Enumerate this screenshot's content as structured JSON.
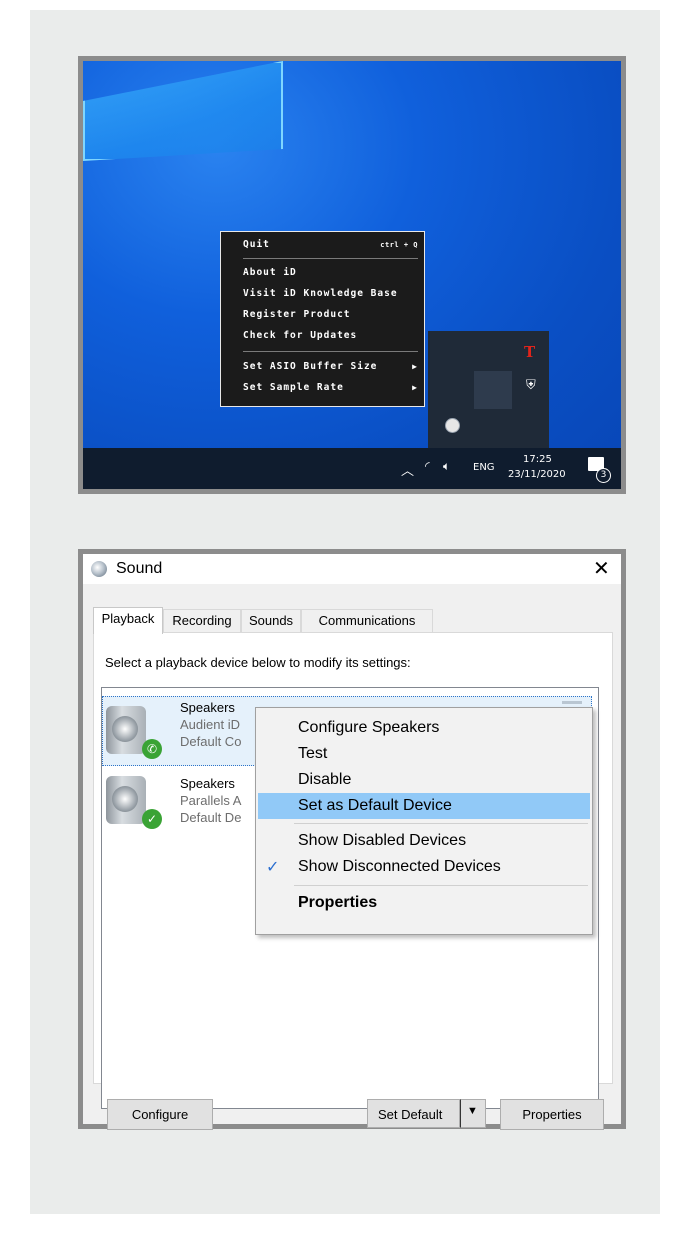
{
  "tray_menu": {
    "items": [
      {
        "label": "Quit",
        "shortcut": "ctrl + Q"
      },
      {
        "label": "About iD"
      },
      {
        "label": "Visit iD Knowledge Base"
      },
      {
        "label": "Register Product"
      },
      {
        "label": "Check for Updates"
      },
      {
        "label": "Set ASIO Buffer Size"
      },
      {
        "label": "Set Sample Rate"
      }
    ]
  },
  "taskbar": {
    "language": "ENG",
    "time": "17:25",
    "date": "23/11/2020",
    "notification_count": "3"
  },
  "sound_dialog": {
    "title": "Sound",
    "tabs": [
      "Playback",
      "Recording",
      "Sounds",
      "Communications"
    ],
    "instruction": "Select a playback device below to modify its settings:",
    "devices": [
      {
        "name": "Speakers",
        "line2": "Audient iD",
        "line3": "Default Co"
      },
      {
        "name": "Speakers",
        "line2": "Parallels A",
        "line3": "Default De"
      }
    ],
    "context_menu": {
      "items": [
        "Configure Speakers",
        "Test",
        "Disable",
        "Set as Default Device",
        "Show Disabled Devices",
        "Show Disconnected Devices",
        "Properties"
      ]
    },
    "buttons": {
      "configure": "Configure",
      "set_default": "Set Default",
      "properties": "Properties"
    }
  },
  "colors": {
    "desktop_blue": "#0a4fc4",
    "highlight": "#91c9f7",
    "taskbar": "#0f1c2e"
  }
}
